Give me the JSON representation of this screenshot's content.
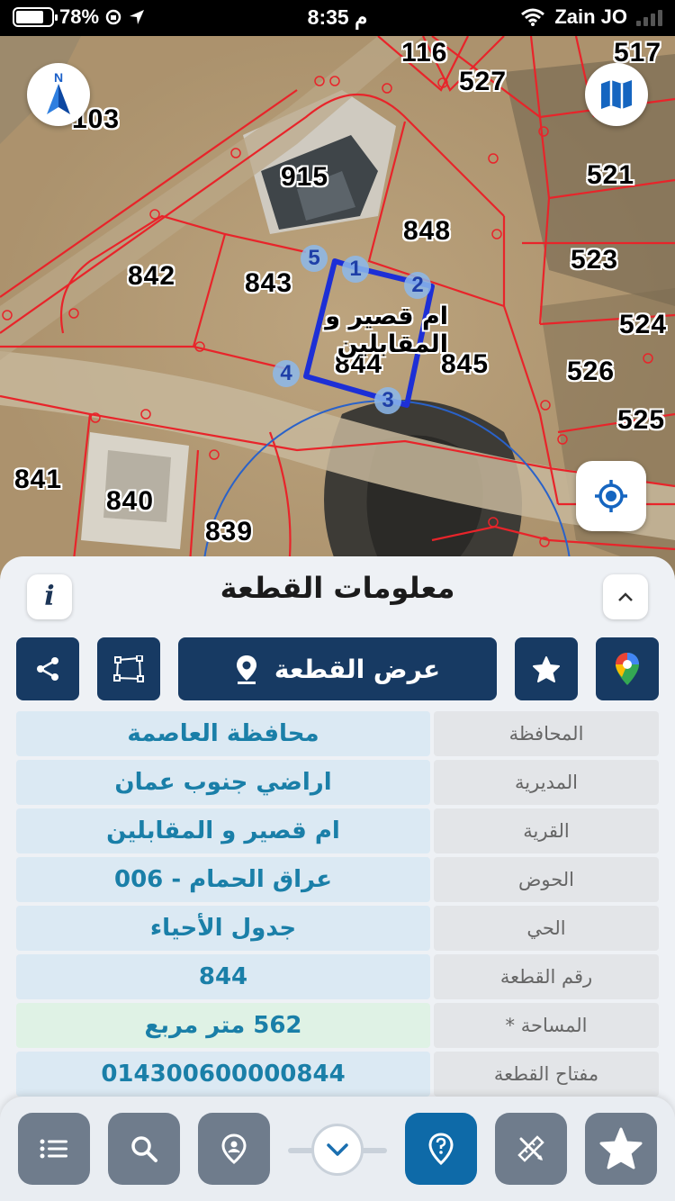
{
  "status_bar": {
    "battery_percent": "78%",
    "battery_level": 0.78,
    "time": "8:35 م",
    "carrier": "Zain JO"
  },
  "map": {
    "parcel_labels": [
      "116",
      "527",
      "517",
      "103",
      "915",
      "521",
      "848",
      "523",
      "842",
      "843",
      "524",
      "844",
      "845",
      "526",
      "525",
      "841",
      "840",
      "839"
    ],
    "village_label": "ام قصير و المقابلين",
    "vertices": [
      "1",
      "2",
      "3",
      "4",
      "5"
    ],
    "compass_letter": "N",
    "colors": {
      "parcel_lines": "#e8242a",
      "selected_outline": "#1d2fd6",
      "radius_circle": "#2a62c9"
    }
  },
  "sheet": {
    "title": "معلومات القطعة",
    "info_icon": "i",
    "actions": {
      "show_parcel": "عرض القطعة"
    },
    "rows": [
      {
        "key": "المحافظة",
        "value": "محافظة العاصمة"
      },
      {
        "key": "المديرية",
        "value": "اراضي جنوب عمان"
      },
      {
        "key": "القرية",
        "value": "ام قصير و المقابلين"
      },
      {
        "key": "الحوض",
        "value": "عراق الحمام - 006"
      },
      {
        "key": "الحي",
        "value": "جدول الأحياء"
      },
      {
        "key": "رقم القطعة",
        "value": "844"
      },
      {
        "key": "المساحة *",
        "value": "562  متر مربع"
      },
      {
        "key": "مفتاح القطعة",
        "value": "014300600000844"
      }
    ]
  },
  "toolbar": {
    "icons": [
      "list-icon",
      "search-icon",
      "location-pin-icon",
      "chevron-down-icon",
      "help-pin-icon",
      "measure-tools-icon",
      "star-icon"
    ],
    "active_color": "#0e6aa8"
  }
}
